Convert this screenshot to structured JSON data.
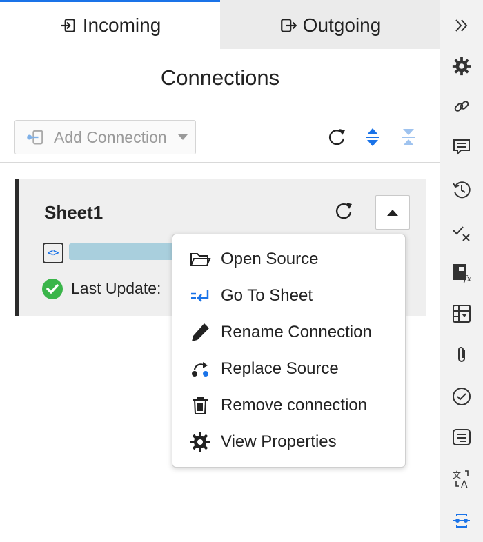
{
  "tabs": {
    "incoming_label": "Incoming",
    "outgoing_label": "Outgoing",
    "active": "incoming"
  },
  "panel": {
    "title": "Connections"
  },
  "toolbar": {
    "add_connection_label": "Add Connection",
    "icons": [
      "refresh-all-icon",
      "expand-all-icon",
      "collapse-all-icon"
    ]
  },
  "connection": {
    "name": "Sheet1",
    "last_update_label": "Last Update:"
  },
  "menu": {
    "items": [
      {
        "label": "Open Source",
        "icon": "folder-open-icon"
      },
      {
        "label": "Go To Sheet",
        "icon": "go-to-sheet-icon"
      },
      {
        "label": "Rename Connection",
        "icon": "pencil-icon"
      },
      {
        "label": "Replace Source",
        "icon": "replace-source-icon"
      },
      {
        "label": "Remove connection",
        "icon": "trash-icon"
      },
      {
        "label": "View Properties",
        "icon": "gear-icon"
      }
    ]
  },
  "rail": {
    "icons": [
      "double-chevron-right-icon",
      "gear-icon",
      "link-icon",
      "comment-icon",
      "history-icon",
      "check-cross-icon",
      "function-table-icon",
      "table-dropdown-icon",
      "paperclip-icon",
      "check-circle-icon",
      "notes-icon",
      "translate-icon",
      "connections-icon"
    ]
  },
  "colors": {
    "accent": "#1a73e8",
    "success": "#3ab54a",
    "source_bar": "#a9cfdd",
    "card_bg": "#efefef"
  }
}
